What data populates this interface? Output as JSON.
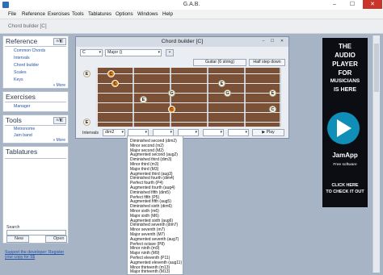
{
  "window": {
    "title": "G.A.B.",
    "min": "–",
    "max": "☐",
    "close": "✕"
  },
  "menu": [
    "File",
    "Reference",
    "Exercises",
    "Tools",
    "Tablatures",
    "Options",
    "Windows",
    "Help"
  ],
  "toolbar": {
    "chord_builder_tab": "Chord builder [C]"
  },
  "sidebar": {
    "reference": {
      "title": "Reference",
      "button": "≡/◧",
      "items": [
        "Common Chords",
        "Intervals",
        "Chord builder",
        "Scales",
        "Keys"
      ],
      "more": "» More"
    },
    "exercises": {
      "title": "Exercises",
      "items": [
        "Manager"
      ]
    },
    "tools": {
      "title": "Tools",
      "button": "≡/◧",
      "items": [
        "Metronome",
        "Jam band"
      ],
      "more": "» More"
    },
    "tablatures": {
      "title": "Tablatures",
      "search_label": "Search",
      "search_value": "",
      "new_label": "New",
      "open_label": "Open"
    },
    "support_text": "Support the developer: Register your copy for 5$"
  },
  "chord_window": {
    "title": "Chord builder [C]",
    "root": "C",
    "quality": "Major ()",
    "guitar_button": "Guitar (6 string)",
    "half_step_button": "Half step down",
    "open_notes": [
      "E",
      "E"
    ],
    "dots": [
      "C",
      "C",
      "E",
      "G",
      "C",
      "E",
      "G",
      "E",
      "C"
    ],
    "intervals_label": "Intervals",
    "interval_select": "dim2",
    "interval_slots": [
      "",
      "",
      "",
      "",
      ""
    ],
    "play_label": "Play"
  },
  "dropdown_options": [
    "Diminished second (dim2)",
    "Minor second (m2)",
    "Major second (M2)",
    "Augmented second (aug2)",
    "Diminished third (dim3)",
    "Minor third (m3)",
    "Major third (M3)",
    "Augmented third (aug3)",
    "Diminished fourth (dim4)",
    "Perfect fourth (P4)",
    "Augmented fourth (aug4)",
    "Diminished fifth (dim5)",
    "Perfect fifth (P5)",
    "Augmented fifth (aug5)",
    "Diminished sixth (dim6)",
    "Minor sixth (m6)",
    "Major sixth (M6)",
    "Augmented sixth (aug6)",
    "Diminished seventh (dim7)",
    "Minor seventh (m7)",
    "Major seventh (M7)",
    "Augmented seventh (aug7)",
    "Perfect octave (P8)",
    "Minor ninth (m9)",
    "Major ninth (M9)",
    "Perfect eleventh (P11)",
    "Augmented eleventh (aug11)",
    "Minor thirteenth (m13)",
    "Major thirteenth (M13)"
  ],
  "ad": {
    "lines": [
      "THE",
      "AUDIO",
      "PLAYER",
      "FOR",
      "MUSICIANS",
      "IS HERE"
    ],
    "brand": "JamApp",
    "tagline": "Free software",
    "cta": [
      "CLICK HERE",
      "TO CHECK IT OUT"
    ]
  },
  "colors": {
    "root_dot": "#e58a18",
    "fretboard": "#7a5036",
    "workspace": "#a6b4c6",
    "ad_accent": "#0f8fb8"
  }
}
